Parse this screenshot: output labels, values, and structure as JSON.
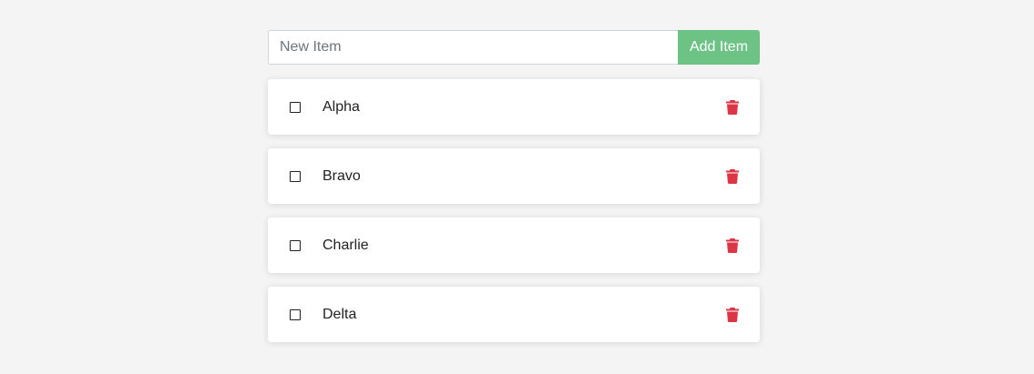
{
  "new_item": {
    "placeholder": "New Item",
    "value": "",
    "add_button_label": "Add Item"
  },
  "items": [
    {
      "label": "Alpha",
      "checked": false
    },
    {
      "label": "Bravo",
      "checked": false
    },
    {
      "label": "Charlie",
      "checked": false
    },
    {
      "label": "Delta",
      "checked": false
    }
  ],
  "colors": {
    "accent": "#6dc285",
    "delete": "#dc3545",
    "background": "#f4f4f4"
  },
  "icons": {
    "checkbox": "checkbox-unchecked-icon",
    "delete": "trash-icon"
  }
}
